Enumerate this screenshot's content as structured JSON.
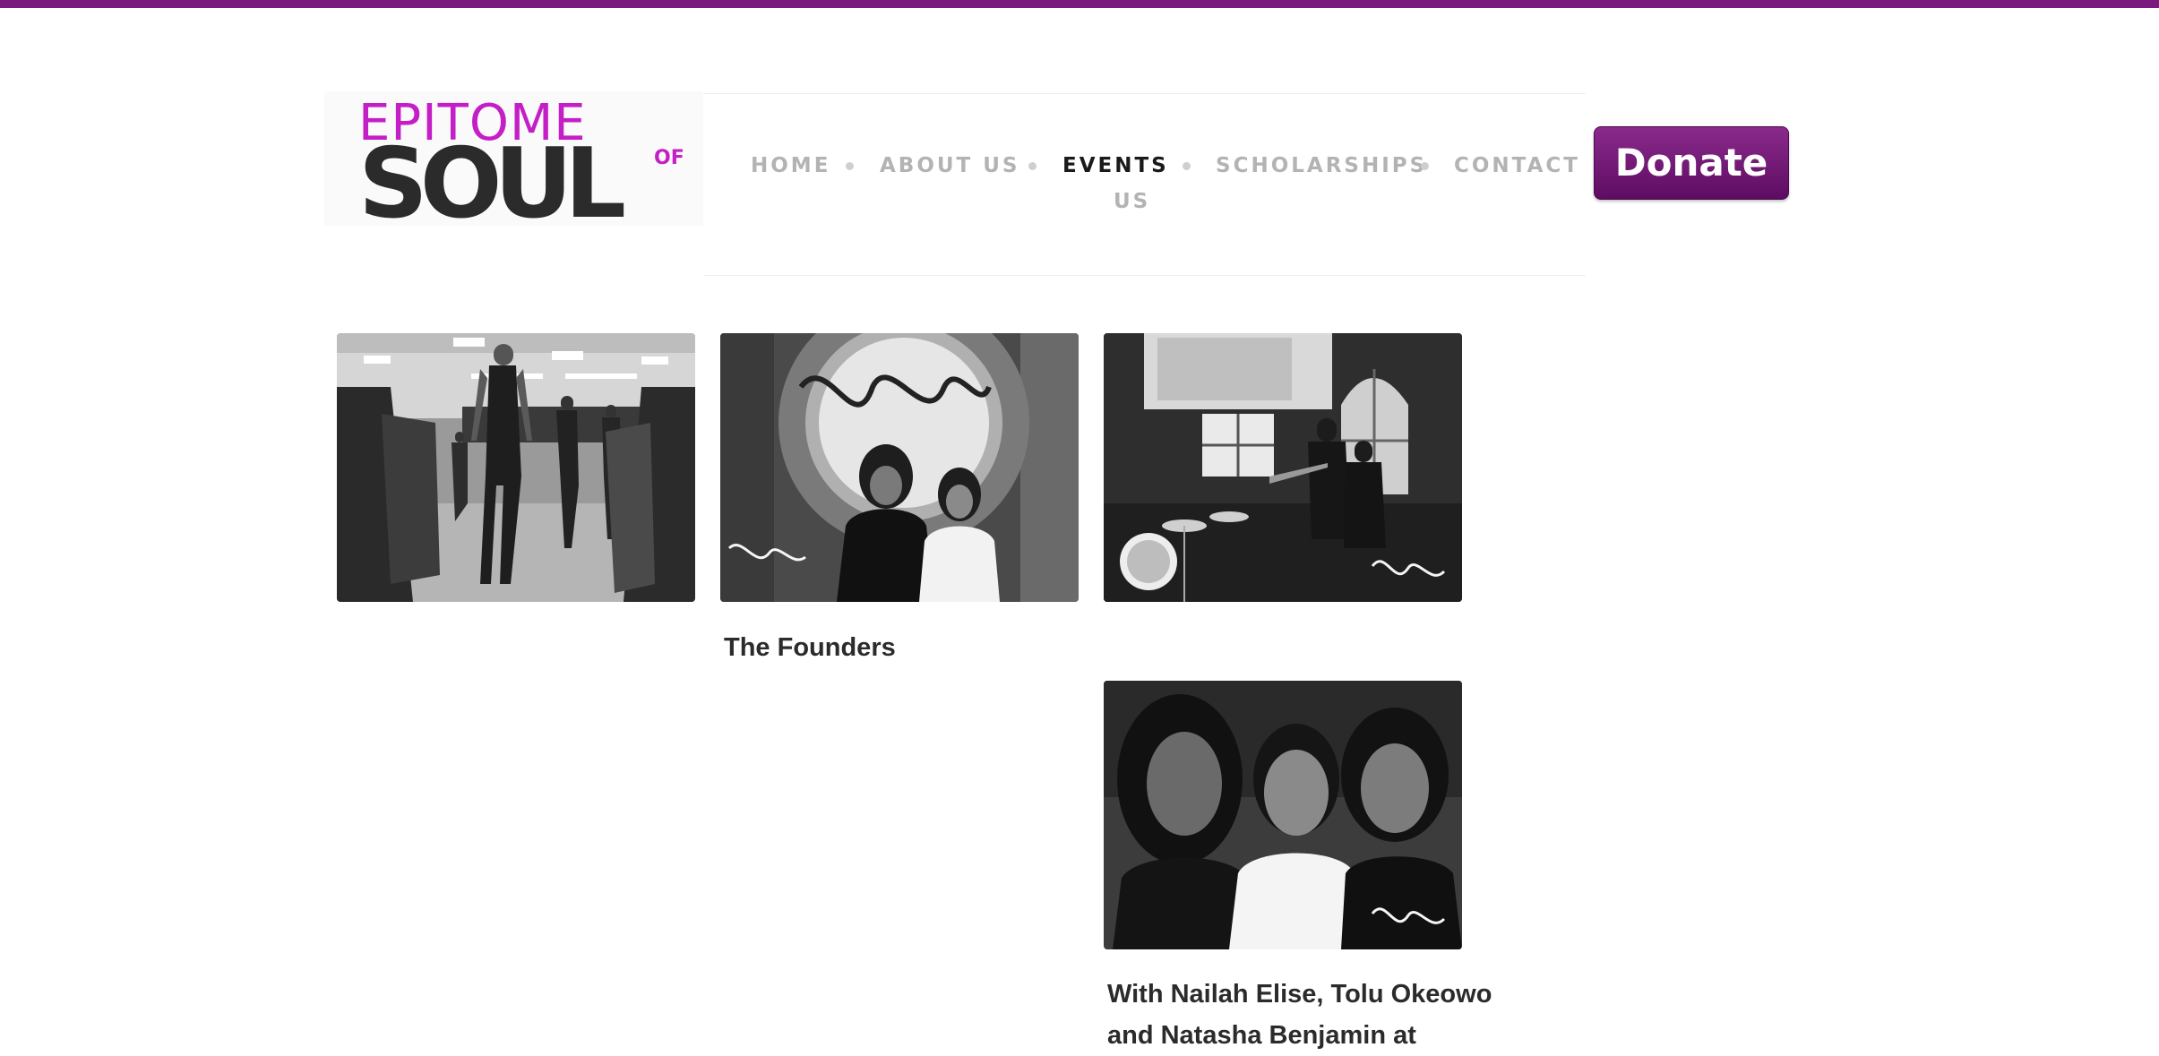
{
  "header": {
    "logo": {
      "line1": "EPITOME",
      "line2": "SOUL",
      "small": "OF"
    },
    "nav": {
      "items": [
        {
          "label": "HOME"
        },
        {
          "label": "ABOUT US"
        },
        {
          "label": "EVENTS",
          "active": true
        },
        {
          "label": "SCHOLARSHIPS"
        },
        {
          "label": "CONTACT"
        },
        {
          "label": "US"
        }
      ]
    },
    "donate_label": "Donate"
  },
  "gallery": {
    "items": [
      {
        "caption": ""
      },
      {
        "caption": "The Founders"
      },
      {
        "caption": ""
      },
      {
        "caption": "With Nailah Elise, Tolu Okeowo",
        "caption_line2": "and Natasha Benjamin at"
      }
    ]
  },
  "colors": {
    "brand_purple": "#7a1a7e",
    "logo_magenta": "#c41fc7",
    "nav_inactive": "#b3b3b3",
    "nav_active": "#1a1a1a"
  }
}
